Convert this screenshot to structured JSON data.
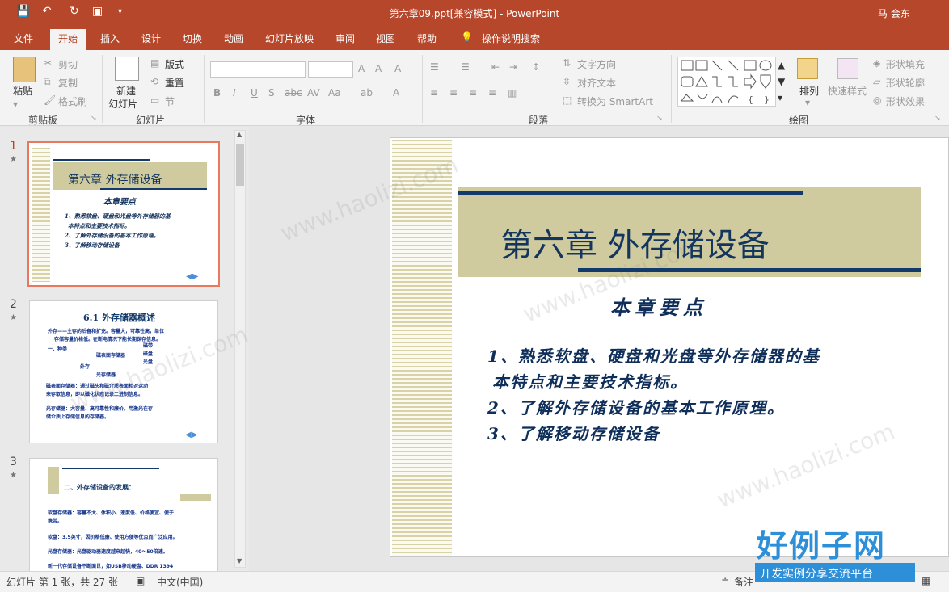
{
  "window": {
    "title": "第六章09.ppt[兼容模式]  -  PowerPoint",
    "user": "马 会东"
  },
  "ribbon_tabs": [
    "文件",
    "开始",
    "插入",
    "设计",
    "切换",
    "动画",
    "幻灯片放映",
    "审阅",
    "视图",
    "帮助",
    "操作说明搜索"
  ],
  "active_tab": "开始",
  "ribbon": {
    "paste": "粘贴",
    "cut": "剪切",
    "copy": "复制",
    "format_painter": "格式刷",
    "clipboard_group": "剪贴板",
    "new_slide": "新建",
    "new_slide2": "幻灯片",
    "layout": "版式",
    "reset": "重置",
    "section": "节",
    "slides_group": "幻灯片",
    "font_group": "字体",
    "text_direction": "文字方向",
    "align_text": "对齐文本",
    "smartart": "转换为 SmartArt",
    "paragraph_group": "段落",
    "arrange": "排列",
    "quick_styles": "快速样式",
    "shape_fill": "形状填充",
    "shape_outline": "形状轮廓",
    "shape_effects": "形状效果",
    "drawing_group": "绘图"
  },
  "thumbnails": [
    {
      "num": "1",
      "title": "第六章  外存储设备",
      "subtitle": "本章要点",
      "lines": [
        "1、熟悉软盘、硬盘和光盘等外存储器的基",
        "本特点和主要技术指标。",
        "2、了解外存储设备的基本工作原理。",
        "3、了解移动存储设备"
      ]
    },
    {
      "num": "2",
      "title": "6.1  外存储器概述",
      "lines": [
        "外存——主存的后备和扩充。容量大，可靠性高，单位",
        "存储容量价格低。在断电情况下能长期保存信息。",
        "一、种类",
        "磁带",
        "磁盘",
        "光盘",
        "外存",
        "磁表面存储器",
        "光存储器",
        "磁表面存储器：通过磁头和磁介质表面相对运动",
        "来存取信息，即以磁化状态记录二进制信息。",
        "光存储器：大容量、高可靠性和廉价。用激光在存",
        "储介质上存储信息的存储器。"
      ]
    },
    {
      "num": "3",
      "title": "二、外存储设备的发展：",
      "lines": [
        "软盘存储器：容量不大、体积小、速度低、价格便宜、便于",
        "携带。",
        "软盘：3.5英寸，因价格低廉、使用方便等优点而广泛应用。",
        "光盘存储器：光盘驱动器速度越来越快，40～50倍速。",
        "新一代存储设备不断面世，如USB移动硬盘、DDR 1394"
      ]
    }
  ],
  "slide": {
    "title": "第六章  外存储设备",
    "subtitle": "本章要点",
    "lines": [
      "1、熟悉软盘、硬盘和光盘等外存储器的基",
      "本特点和主要技术指标。",
      "2、了解外存储设备的基本工作原理。",
      "3、了解移动存储设备"
    ]
  },
  "status": {
    "slide_info": "幻灯片 第 1 张，共 27 张",
    "language": "中文(中国)",
    "notes": "备注"
  },
  "watermark": {
    "brand": "好例子网",
    "tagline": "开发实例分享交流平台",
    "url": "www.haolizi.com"
  },
  "colors": {
    "accent": "#b7472a",
    "navy": "#123a6a",
    "banner": "#cfcb9f"
  }
}
